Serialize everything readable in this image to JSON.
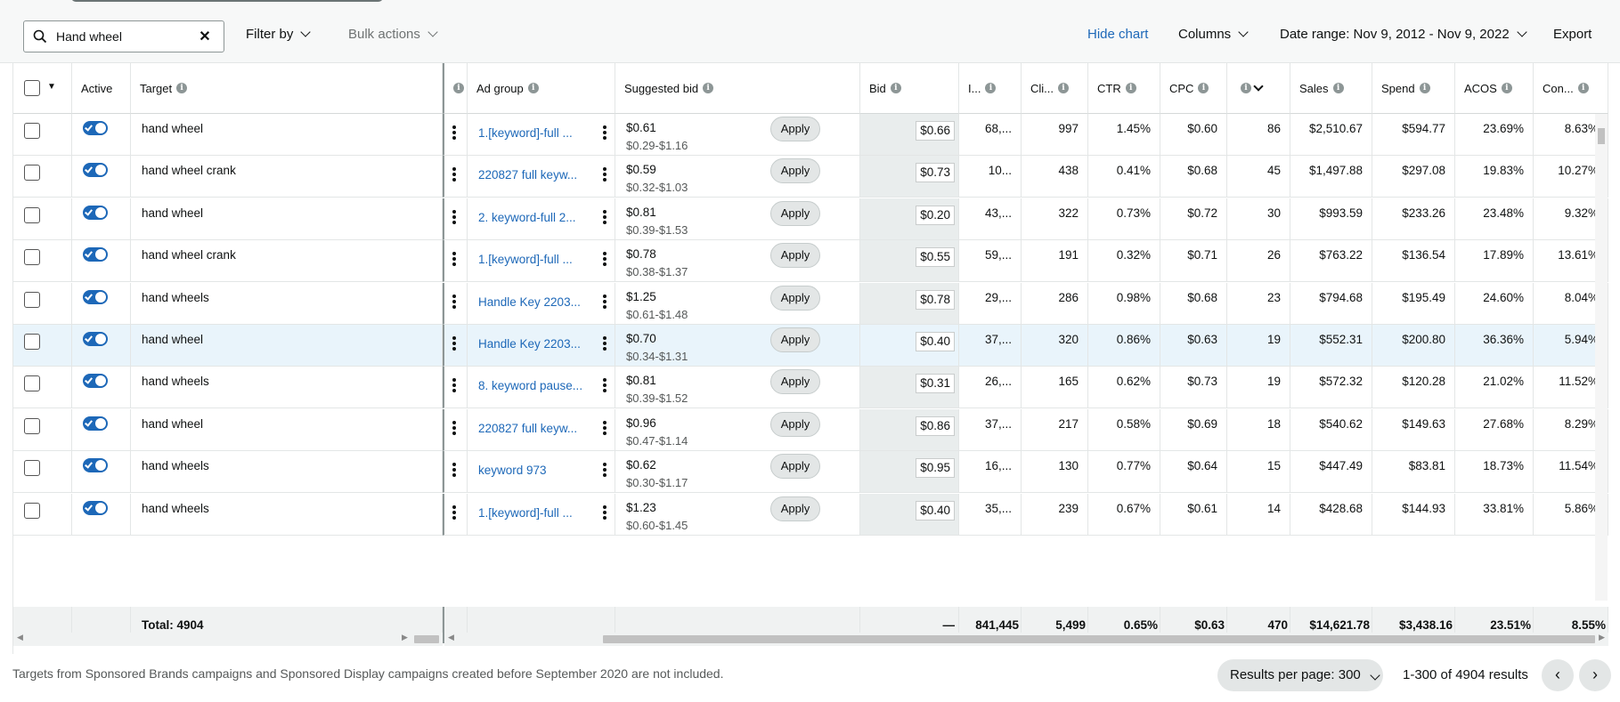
{
  "toolbar": {
    "search_value": "Hand wheel",
    "filter_label": "Filter by",
    "bulk_label": "Bulk actions",
    "hide_chart_label": "Hide chart",
    "columns_label": "Columns",
    "date_range_label": "Date range: Nov 9, 2012 - Nov 9, 2022",
    "export_label": "Export"
  },
  "headers": {
    "active": "Active",
    "target": "Target",
    "ad_group": "Ad group",
    "suggested_bid": "Suggested bid",
    "bid": "Bid",
    "impressions": "I...",
    "clicks": "Cli...",
    "ctr": "CTR",
    "cpc": "CPC",
    "orders": "",
    "sales": "Sales",
    "spend": "Spend",
    "acos": "ACOS",
    "conversion": "Con..."
  },
  "apply_label": "Apply",
  "rows": [
    {
      "target": "hand wheel",
      "ad_group": "1.[keyword]-full ...",
      "sugg": "$0.61",
      "range": "$0.29-$1.16",
      "bid": "$0.66",
      "impr": "68,...",
      "clicks": "997",
      "ctr": "1.45%",
      "cpc": "$0.60",
      "orders": "86",
      "sales": "$2,510.67",
      "spend": "$594.77",
      "acos": "23.69%",
      "conv": "8.63%"
    },
    {
      "target": "hand wheel crank",
      "ad_group": "220827 full keyw...",
      "sugg": "$0.59",
      "range": "$0.32-$1.03",
      "bid": "$0.73",
      "impr": "10...",
      "clicks": "438",
      "ctr": "0.41%",
      "cpc": "$0.68",
      "orders": "45",
      "sales": "$1,497.88",
      "spend": "$297.08",
      "acos": "19.83%",
      "conv": "10.27%"
    },
    {
      "target": "hand wheel",
      "ad_group": "2. keyword-full 2...",
      "sugg": "$0.81",
      "range": "$0.39-$1.53",
      "bid": "$0.20",
      "impr": "43,...",
      "clicks": "322",
      "ctr": "0.73%",
      "cpc": "$0.72",
      "orders": "30",
      "sales": "$993.59",
      "spend": "$233.26",
      "acos": "23.48%",
      "conv": "9.32%"
    },
    {
      "target": "hand wheel crank",
      "ad_group": "1.[keyword]-full ...",
      "sugg": "$0.78",
      "range": "$0.38-$1.37",
      "bid": "$0.55",
      "impr": "59,...",
      "clicks": "191",
      "ctr": "0.32%",
      "cpc": "$0.71",
      "orders": "26",
      "sales": "$763.22",
      "spend": "$136.54",
      "acos": "17.89%",
      "conv": "13.61%"
    },
    {
      "target": "hand wheels",
      "ad_group": "Handle Key 2203...",
      "sugg": "$1.25",
      "range": "$0.61-$1.48",
      "bid": "$0.78",
      "impr": "29,...",
      "clicks": "286",
      "ctr": "0.98%",
      "cpc": "$0.68",
      "orders": "23",
      "sales": "$794.68",
      "spend": "$195.49",
      "acos": "24.60%",
      "conv": "8.04%"
    },
    {
      "target": "hand wheel",
      "ad_group": "Handle Key 2203...",
      "sugg": "$0.70",
      "range": "$0.34-$1.31",
      "bid": "$0.40",
      "impr": "37,...",
      "clicks": "320",
      "ctr": "0.86%",
      "cpc": "$0.63",
      "orders": "19",
      "sales": "$552.31",
      "spend": "$200.80",
      "acos": "36.36%",
      "conv": "5.94%"
    },
    {
      "target": "hand wheels",
      "ad_group": "8. keyword pause...",
      "sugg": "$0.81",
      "range": "$0.39-$1.52",
      "bid": "$0.31",
      "impr": "26,...",
      "clicks": "165",
      "ctr": "0.62%",
      "cpc": "$0.73",
      "orders": "19",
      "sales": "$572.32",
      "spend": "$120.28",
      "acos": "21.02%",
      "conv": "11.52%"
    },
    {
      "target": "hand wheel",
      "ad_group": "220827 full keyw...",
      "sugg": "$0.96",
      "range": "$0.47-$1.14",
      "bid": "$0.86",
      "impr": "37,...",
      "clicks": "217",
      "ctr": "0.58%",
      "cpc": "$0.69",
      "orders": "18",
      "sales": "$540.62",
      "spend": "$149.63",
      "acos": "27.68%",
      "conv": "8.29%"
    },
    {
      "target": "hand wheels",
      "ad_group": "keyword 973",
      "sugg": "$0.62",
      "range": "$0.30-$1.17",
      "bid": "$0.95",
      "impr": "16,...",
      "clicks": "130",
      "ctr": "0.77%",
      "cpc": "$0.64",
      "orders": "15",
      "sales": "$447.49",
      "spend": "$83.81",
      "acos": "18.73%",
      "conv": "11.54%"
    },
    {
      "target": "hand wheels",
      "ad_group": "1.[keyword]-full ...",
      "sugg": "$1.23",
      "range": "$0.60-$1.45",
      "bid": "$0.40",
      "impr": "35,...",
      "clicks": "239",
      "ctr": "0.67%",
      "cpc": "$0.61",
      "orders": "14",
      "sales": "$428.68",
      "spend": "$144.93",
      "acos": "33.81%",
      "conv": "5.86%"
    }
  ],
  "totals": {
    "label": "Total: 4904",
    "bid": "—",
    "impr": "841,445",
    "clicks": "5,499",
    "ctr": "0.65%",
    "cpc": "$0.63",
    "orders": "470",
    "sales": "$14,621.78",
    "spend": "$3,438.16",
    "acos": "23.51%",
    "conv": "8.55%"
  },
  "footer": {
    "note": "Targets from Sponsored Brands campaigns and Sponsored Display campaigns created before September 2020 are not included.",
    "results_per_page": "Results per page: 300",
    "results_count": "1-300 of 4904 results",
    "prev_icon": "‹",
    "next_icon": "›"
  },
  "colors": {
    "accent": "#1d68b8",
    "selected_row": "#e9f4fb"
  }
}
